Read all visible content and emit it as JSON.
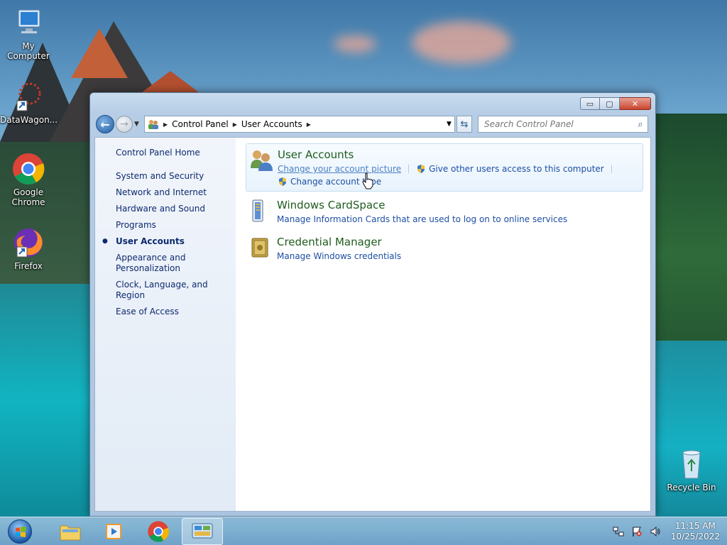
{
  "desktop": {
    "icons": [
      {
        "label": "My Computer"
      },
      {
        "label": "DataWagon..."
      },
      {
        "label": "Google Chrome"
      },
      {
        "label": "Firefox"
      },
      {
        "label": "Recycle Bin"
      }
    ]
  },
  "window": {
    "controls": {
      "minimize": "▭",
      "maximize": "▢",
      "close": "✕"
    },
    "address": {
      "crumbs": [
        "Control Panel",
        "User Accounts"
      ]
    },
    "search": {
      "placeholder": "Search Control Panel"
    },
    "sidebar": {
      "items": [
        "Control Panel Home",
        "System and Security",
        "Network and Internet",
        "Hardware and Sound",
        "Programs",
        "User Accounts",
        "Appearance and Personalization",
        "Clock, Language, and Region",
        "Ease of Access"
      ],
      "active": "User Accounts"
    },
    "groups": [
      {
        "title": "User Accounts",
        "links": [
          "Change your account picture",
          "Give other users access to this computer",
          "Change account type"
        ]
      },
      {
        "title": "Windows CardSpace",
        "links": [
          "Manage Information Cards that are used to log on to online services"
        ]
      },
      {
        "title": "Credential Manager",
        "links": [
          "Manage Windows credentials"
        ]
      }
    ]
  },
  "taskbar": {
    "clock": {
      "time": "11:15 AM",
      "date": "10/25/2022"
    }
  },
  "colors": {
    "link": "#1c4fa5",
    "group_title": "#1e5c1e",
    "sidebar_text": "#0e2a6e"
  }
}
